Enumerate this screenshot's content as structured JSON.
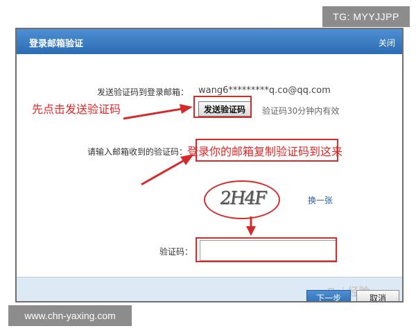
{
  "watermarks": {
    "top": "TG: MYYJJPP",
    "bottom": "www.chn-yaxing.com",
    "baidu": "Bai 经验"
  },
  "dialog": {
    "title": "登录邮箱验证",
    "close_label": "关闭",
    "send_label": "发送验证码到登录邮箱：",
    "email": "wang6*********q.co@qq.com",
    "send_button": "发送验证码",
    "valid_note": "验证码30分钟内有效",
    "enter_label": "请输入邮箱收到的验证码：",
    "captcha_text": "2H4F",
    "refresh_link": "换一张",
    "code_label": "验证码：",
    "next_button": "下一步",
    "cancel_button": "取消"
  },
  "annotations": {
    "click_send": "先点击发送验证码",
    "copy_here": "登录你的邮箱复制验证码到这来"
  },
  "colors": {
    "annotation_red": "#d42a2a",
    "titlebar_blue": "#3a7cc4",
    "link_blue": "#2a5db0"
  }
}
